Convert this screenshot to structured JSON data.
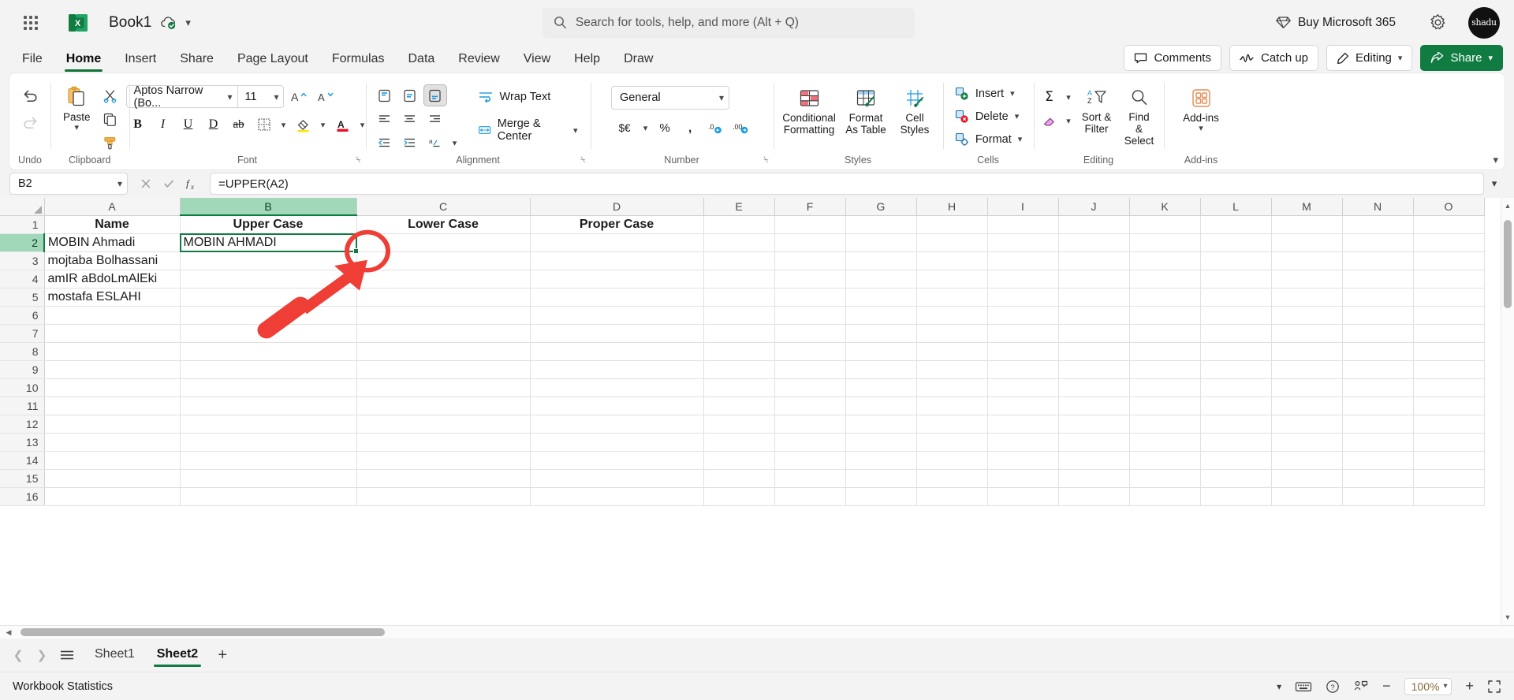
{
  "titlebar": {
    "app_launcher": "app-launcher",
    "workbook_name": "Book1",
    "autosave_status": "cloud-saved",
    "search_placeholder": "Search for tools, help, and more (Alt + Q)",
    "buy_label": "Buy Microsoft 365",
    "settings_label": "Settings",
    "avatar_initials": "shadu"
  },
  "tabs": [
    {
      "label": "File",
      "active": false
    },
    {
      "label": "Home",
      "active": true
    },
    {
      "label": "Insert",
      "active": false
    },
    {
      "label": "Share",
      "active": false
    },
    {
      "label": "Page Layout",
      "active": false
    },
    {
      "label": "Formulas",
      "active": false
    },
    {
      "label": "Data",
      "active": false
    },
    {
      "label": "Review",
      "active": false
    },
    {
      "label": "View",
      "active": false
    },
    {
      "label": "Help",
      "active": false
    },
    {
      "label": "Draw",
      "active": false
    }
  ],
  "tab_actions": {
    "comments": "Comments",
    "catch_up": "Catch up",
    "editing": "Editing",
    "share": "Share"
  },
  "ribbon": {
    "groups": [
      {
        "name": "Undo",
        "label": "Undo"
      },
      {
        "name": "Clipboard",
        "label": "Clipboard"
      },
      {
        "name": "Font",
        "label": "Font"
      },
      {
        "name": "Alignment",
        "label": "Alignment"
      },
      {
        "name": "Number",
        "label": "Number"
      },
      {
        "name": "Styles",
        "label": "Styles"
      },
      {
        "name": "Cells",
        "label": "Cells"
      },
      {
        "name": "Editing",
        "label": "Editing"
      },
      {
        "name": "Add-ins",
        "label": "Add-ins"
      }
    ],
    "paste_label": "Paste",
    "font_name": "Aptos Narrow (Bo...",
    "font_size": "11",
    "wrap_text": "Wrap Text",
    "merge_center": "Merge & Center",
    "number_format": "General",
    "conditional_formatting": "Conditional Formatting",
    "format_as_table": "Format As Table",
    "cell_styles": "Cell Styles",
    "insert": "Insert",
    "delete": "Delete",
    "format": "Format",
    "sort_filter": "Sort & Filter",
    "find_select": "Find & Select",
    "addins": "Add-ins"
  },
  "formula_bar": {
    "name_box": "B2",
    "formula": "=UPPER(A2)",
    "cancel": "cancel-edit",
    "enter": "confirm-edit",
    "insert_function": "insert-function"
  },
  "grid": {
    "columns": [
      "A",
      "B",
      "C",
      "D",
      "E",
      "F",
      "G",
      "H",
      "I",
      "J",
      "K",
      "L",
      "M",
      "N",
      "O"
    ],
    "selected_column": "B",
    "rows": [
      "1",
      "2",
      "3",
      "4",
      "5",
      "6",
      "7",
      "8",
      "9",
      "10",
      "11",
      "12",
      "13",
      "14",
      "15",
      "16"
    ],
    "selected_row": "2",
    "active_cell": "B2",
    "data": [
      {
        "row": "1",
        "A": "Name",
        "B": "Upper Case",
        "C": "Lower Case",
        "D": "Proper Case",
        "header": true
      },
      {
        "row": "2",
        "A": "MOBIN Ahmadi",
        "B": "MOBIN AHMADI",
        "C": "",
        "D": ""
      },
      {
        "row": "3",
        "A": "mojtaba Bolhassani",
        "B": "",
        "C": "",
        "D": ""
      },
      {
        "row": "4",
        "A": "amIR aBdoLmAlEki",
        "B": "",
        "C": "",
        "D": ""
      },
      {
        "row": "5",
        "A": "mostafa ESLAHI",
        "B": "",
        "C": "",
        "D": ""
      },
      {
        "row": "6",
        "A": "",
        "B": "",
        "C": "",
        "D": ""
      },
      {
        "row": "7",
        "A": "",
        "B": "",
        "C": "",
        "D": ""
      },
      {
        "row": "8",
        "A": "",
        "B": "",
        "C": "",
        "D": ""
      },
      {
        "row": "9",
        "A": "",
        "B": "",
        "C": "",
        "D": ""
      },
      {
        "row": "10",
        "A": "",
        "B": "",
        "C": "",
        "D": ""
      },
      {
        "row": "11",
        "A": "",
        "B": "",
        "C": "",
        "D": ""
      },
      {
        "row": "12",
        "A": "",
        "B": "",
        "C": "",
        "D": ""
      },
      {
        "row": "13",
        "A": "",
        "B": "",
        "C": "",
        "D": ""
      },
      {
        "row": "14",
        "A": "",
        "B": "",
        "C": "",
        "D": ""
      },
      {
        "row": "15",
        "A": "",
        "B": "",
        "C": "",
        "D": ""
      },
      {
        "row": "16",
        "A": "",
        "B": "",
        "C": "",
        "D": ""
      }
    ]
  },
  "sheet_tabs": {
    "sheets": [
      {
        "label": "Sheet1",
        "active": false
      },
      {
        "label": "Sheet2",
        "active": true
      }
    ],
    "add_label": "+",
    "all_sheets": "all-sheets"
  },
  "status_bar": {
    "workbook_statistics": "Workbook Statistics",
    "zoom_level": "100%"
  },
  "colors": {
    "accent_green": "#107c41",
    "selection_green": "#a0d8b9",
    "annotation_red": "#ef3e36"
  }
}
